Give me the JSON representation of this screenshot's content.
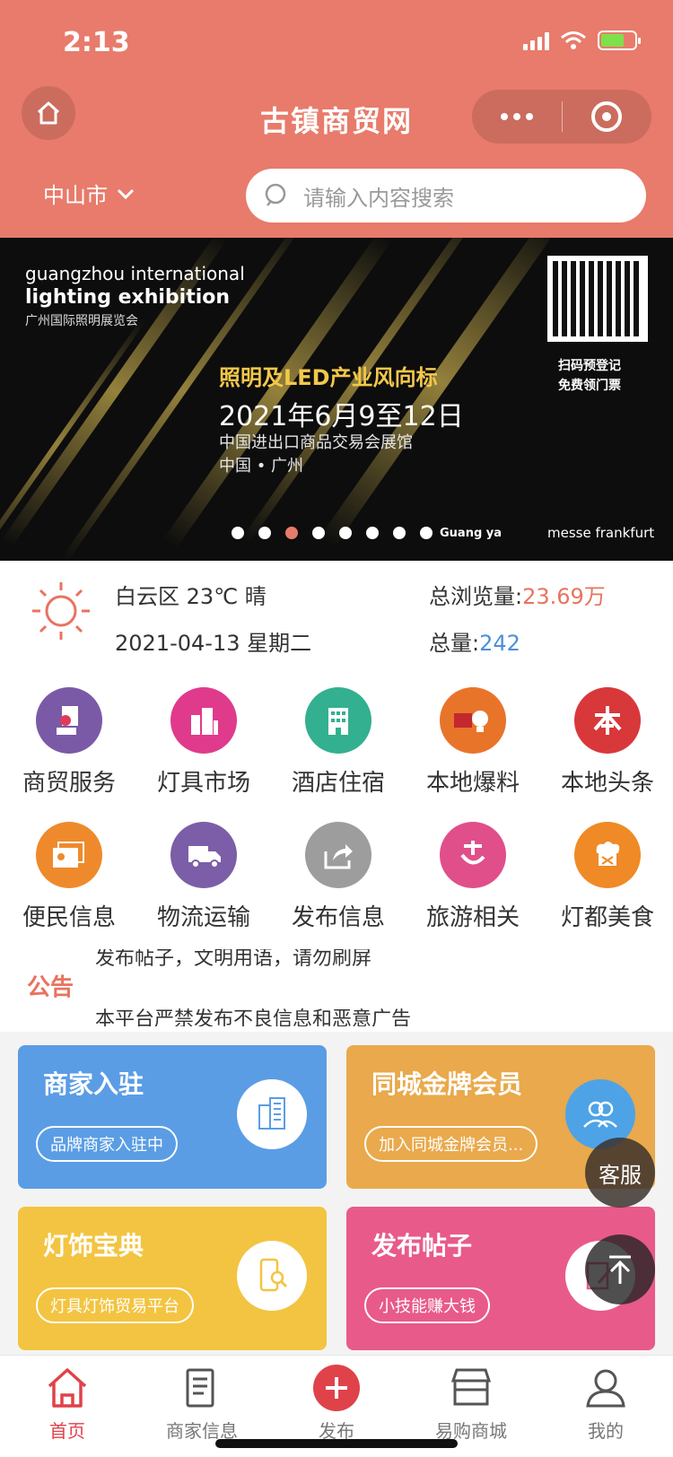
{
  "status_bar": {
    "time": "2:13"
  },
  "header": {
    "title": "古镇商贸网",
    "city": "中山市",
    "search_placeholder": "请输入内容搜索"
  },
  "banner": {
    "en_line1": "guangzhou international",
    "en_line2": "lighting exhibition",
    "cn_name": "广州国际照明展览会",
    "slogan": "照明及LED产业风向标",
    "date": "2021年6月9至12日",
    "venue": "中国进出口商品交易会展馆",
    "city": "中国 • 广州",
    "qr_text1": "扫码预登记",
    "qr_text2": "免费领门票",
    "logo1": "Guang ya",
    "logo2": "messe frankfurt",
    "slide_count": 8,
    "active_slide": 3
  },
  "info": {
    "weather": "白云区 23℃ 晴",
    "date": "2021-04-13 星期二",
    "total_views_label": "总浏览量:",
    "total_views_value": "23.69万",
    "total_label": "总量:",
    "total_value": "242"
  },
  "grid": [
    {
      "label": "商贸服务",
      "icon": "business-person-icon",
      "color": "#7a5aa6"
    },
    {
      "label": "灯具市场",
      "icon": "building-icon",
      "color": "#e03a8c"
    },
    {
      "label": "酒店住宿",
      "icon": "hotel-icon",
      "color": "#33b08f"
    },
    {
      "label": "本地爆料",
      "icon": "bulb-news-icon",
      "color": "#e8742a"
    },
    {
      "label": "本地头条",
      "icon": "headline-icon",
      "color": "#d8383a"
    },
    {
      "label": "便民信息",
      "icon": "info-card-icon",
      "color": "#ee8a2c"
    },
    {
      "label": "物流运输",
      "icon": "truck-icon",
      "color": "#7b5ea7"
    },
    {
      "label": "发布信息",
      "icon": "share-icon",
      "color": "#9d9d9d"
    },
    {
      "label": "旅游相关",
      "icon": "travel-icon",
      "color": "#e04f8a"
    },
    {
      "label": "灯都美食",
      "icon": "chef-icon",
      "color": "#ef8a26"
    }
  ],
  "notice": {
    "tag": "公告",
    "line1": "发布帖子，文明用语，请勿刷屏",
    "line2": "本平台严禁发布不良信息和恶意广告"
  },
  "cards": [
    {
      "title": "商家入驻",
      "pill": "品牌商家入驻中",
      "color": "#5a9de5",
      "icon": "building-card-icon"
    },
    {
      "title": "同城金牌会员",
      "pill": "加入同城金牌会员...",
      "color": "#e9a94c",
      "icon": "members-icon"
    },
    {
      "title": "灯饰宝典",
      "pill": "灯具灯饰贸易平台",
      "color": "#f3c441",
      "icon": "phone-search-icon"
    },
    {
      "title": "发布帖子",
      "pill": "小技能赚大钱",
      "color": "#e85a8a",
      "icon": "edit-post-icon"
    }
  ],
  "floating": {
    "kefu": "客服"
  },
  "tabbar": [
    {
      "label": "首页",
      "icon": "home-icon",
      "active": true
    },
    {
      "label": "商家信息",
      "icon": "list-icon",
      "active": false
    },
    {
      "label": "发布",
      "icon": "plus-icon",
      "active": false
    },
    {
      "label": "易购商城",
      "icon": "shop-icon",
      "active": false
    },
    {
      "label": "我的",
      "icon": "user-icon",
      "active": false
    }
  ]
}
